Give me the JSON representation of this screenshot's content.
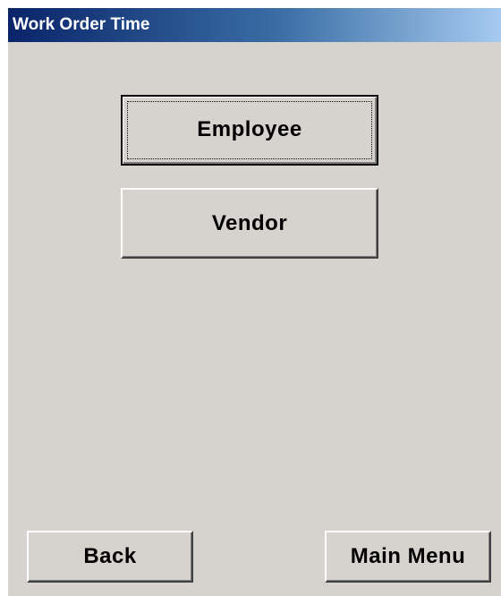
{
  "window": {
    "title": "Work Order Time"
  },
  "buttons": {
    "employee": "Employee",
    "vendor": "Vendor",
    "back": "Back",
    "main_menu": "Main Menu"
  },
  "colors": {
    "window_background": "#d6d3ce",
    "titlebar_start": "#0a246a",
    "titlebar_end": "#a6caf0",
    "title_text": "#ffffff"
  }
}
